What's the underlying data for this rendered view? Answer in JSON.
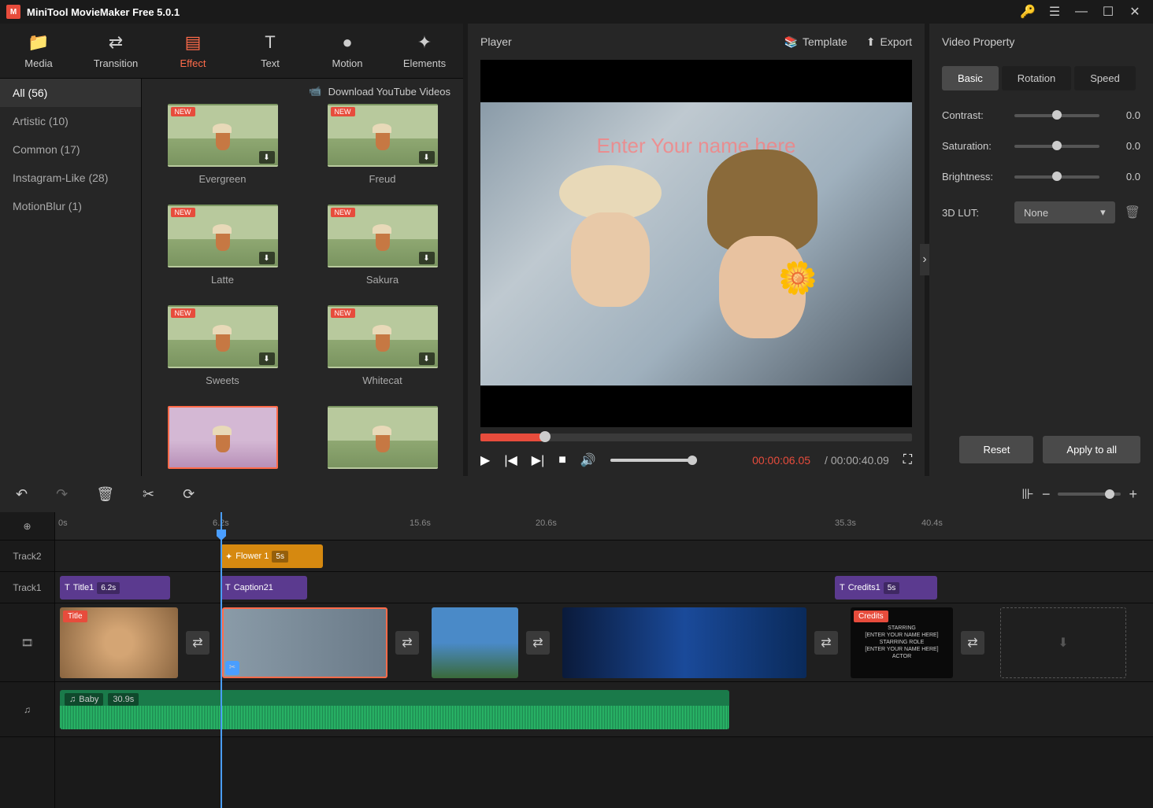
{
  "app": {
    "title": "MiniTool MovieMaker Free 5.0.1"
  },
  "mainTabs": [
    {
      "label": "Media"
    },
    {
      "label": "Transition"
    },
    {
      "label": "Effect"
    },
    {
      "label": "Text"
    },
    {
      "label": "Motion"
    },
    {
      "label": "Elements"
    }
  ],
  "effectCategories": [
    {
      "label": "All (56)"
    },
    {
      "label": "Artistic (10)"
    },
    {
      "label": "Common (17)"
    },
    {
      "label": "Instagram-Like (28)"
    },
    {
      "label": "MotionBlur (1)"
    }
  ],
  "downloadYoutube": "Download YouTube Videos",
  "effects": [
    {
      "name": "Evergreen"
    },
    {
      "name": "Freud"
    },
    {
      "name": "Latte"
    },
    {
      "name": "Sakura"
    },
    {
      "name": "Sweets"
    },
    {
      "name": "Whitecat"
    }
  ],
  "player": {
    "title": "Player",
    "template": "Template",
    "export": "Export",
    "previewText": "Enter Your name here",
    "currentTime": "00:00:06.05",
    "totalTime": "/  00:00:40.09"
  },
  "props": {
    "title": "Video Property",
    "tabs": [
      {
        "label": "Basic"
      },
      {
        "label": "Rotation"
      },
      {
        "label": "Speed"
      }
    ],
    "contrast": {
      "label": "Contrast:",
      "value": "0.0"
    },
    "saturation": {
      "label": "Saturation:",
      "value": "0.0"
    },
    "brightness": {
      "label": "Brightness:",
      "value": "0.0"
    },
    "lut": {
      "label": "3D LUT:",
      "value": "None"
    },
    "reset": "Reset",
    "apply": "Apply to all"
  },
  "timeline": {
    "ruler": [
      "0s",
      "6.2s",
      "15.6s",
      "20.6s",
      "35.3s",
      "40.4s"
    ],
    "track2": "Track2",
    "track1": "Track1",
    "clips": {
      "flower": {
        "name": "Flower 1",
        "dur": "5s"
      },
      "title1": {
        "name": "Title1",
        "dur": "6.2s"
      },
      "caption": {
        "name": "Caption21"
      },
      "credits": {
        "name": "Credits1",
        "dur": "5s"
      }
    },
    "videoClips": {
      "title": "Title",
      "credits": "Credits"
    },
    "audio": {
      "name": "Baby",
      "dur": "30.9s"
    }
  }
}
